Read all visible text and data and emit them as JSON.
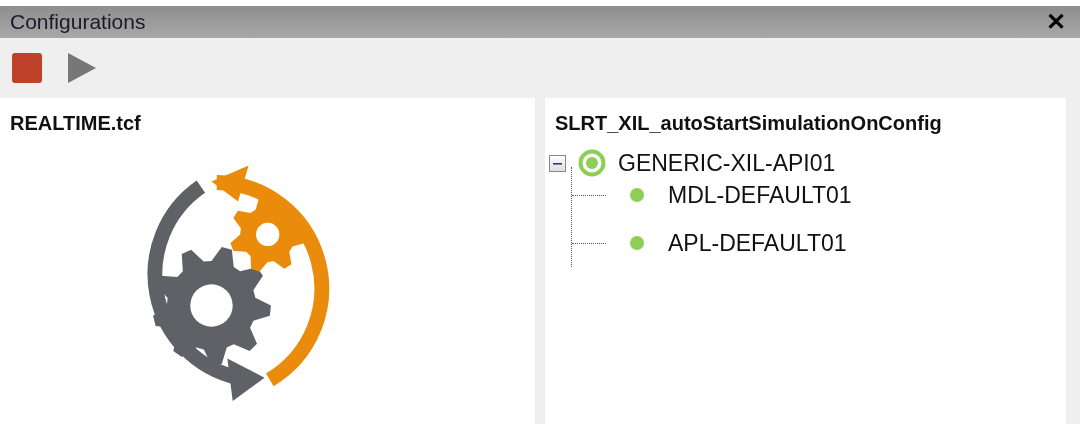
{
  "window": {
    "title": "Configurations",
    "close": "✕"
  },
  "toolbar": [
    {
      "kind": "stop"
    },
    {
      "kind": "play"
    }
  ],
  "left_panel": {
    "title": "REALTIME.tcf"
  },
  "right_panel": {
    "title": "SLRT_XIL_autoStartSimulationOnConfig",
    "tree": [
      {
        "label": "GENERIC-XIL-API01",
        "expanded": true,
        "children": [
          {
            "label": "MDL-DEFAULT01"
          },
          {
            "label": "APL-DEFAULT01"
          }
        ]
      }
    ]
  }
}
